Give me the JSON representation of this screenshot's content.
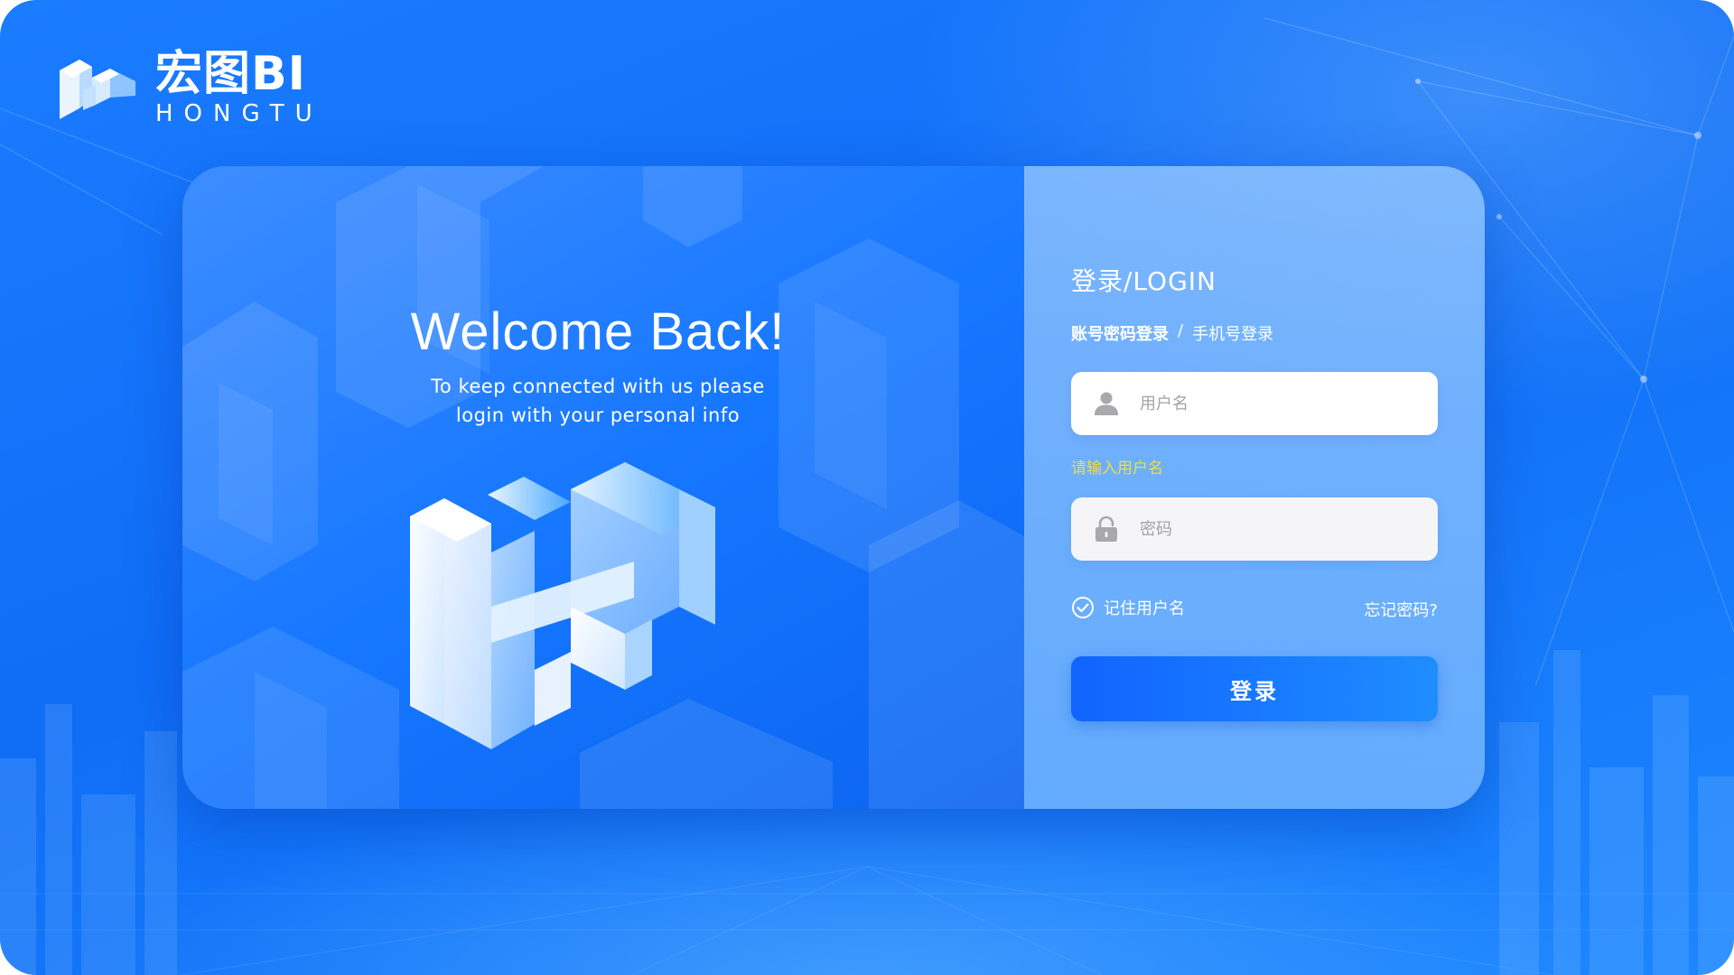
{
  "brand": {
    "title": "宏图BI",
    "subtitle": "HONGTU",
    "logo_icon": "hongtu-cube-logo-icon"
  },
  "welcome": {
    "title": "Welcome Back!",
    "line1": "To keep connected with us please",
    "line2": "login with your personal info"
  },
  "login": {
    "title": "登录/LOGIN",
    "mode_account": "账号密码登录",
    "mode_separator": "/",
    "mode_phone": "手机号登录",
    "username_placeholder": "用户名",
    "username_icon": "user-icon",
    "username_error": "请输入用户名",
    "password_placeholder": "密码",
    "password_icon": "lock-icon",
    "remember_label": "记住用户名",
    "remember_checked": true,
    "forgot_label": "忘记密码?",
    "submit_label": "登录"
  },
  "colors": {
    "background": "#1677ff",
    "accent": "#1064ff",
    "error": "#f3dc3d",
    "panel_right": "#96c8ff"
  }
}
